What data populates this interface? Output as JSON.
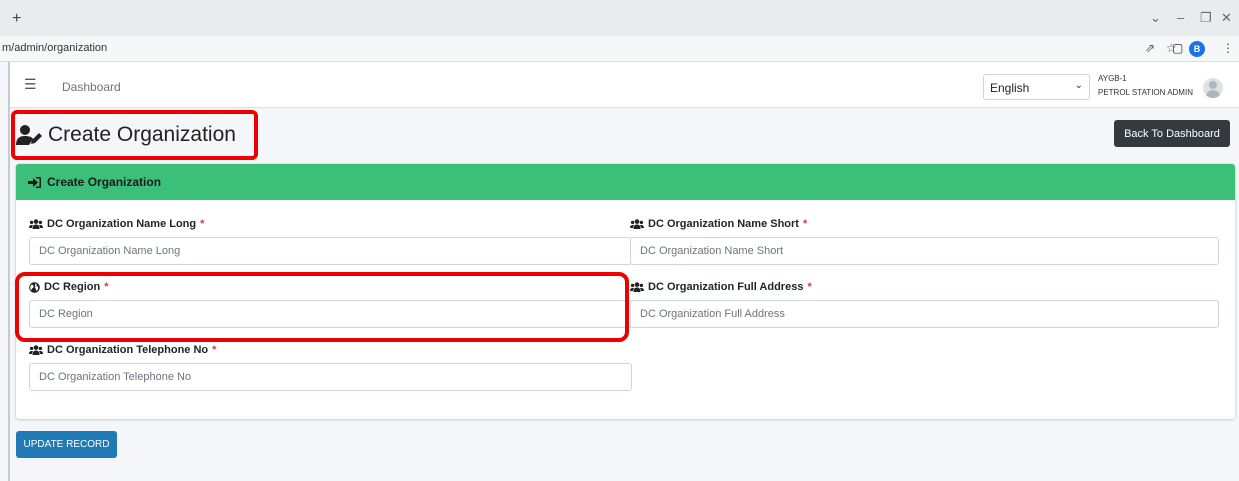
{
  "browser": {
    "new_tab": "+",
    "url": "m/admin/organization",
    "profile_initial": "B"
  },
  "navbar": {
    "dashboard_link": "Dashboard",
    "language": "English",
    "user_name": "AYGB-1",
    "user_role": "PETROL STATION ADMIN"
  },
  "page": {
    "title": "Create Organization",
    "back_button": "Back To Dashboard"
  },
  "form": {
    "header": "Create Organization",
    "required_marker": "*",
    "fields": {
      "name_long": {
        "label": "DC Organization Name Long",
        "placeholder": "DC Organization Name Long",
        "icon": "users-icon"
      },
      "name_short": {
        "label": "DC Organization Name Short",
        "placeholder": "DC Organization Name Short",
        "icon": "users-icon"
      },
      "region": {
        "label": "DC Region",
        "placeholder": "DC Region",
        "icon": "globe-icon"
      },
      "full_address": {
        "label": "DC Organization Full Address",
        "placeholder": "DC Organization Full Address",
        "icon": "users-icon"
      },
      "telephone": {
        "label": "DC Organization Telephone No",
        "placeholder": "DC Organization Telephone No",
        "icon": "users-icon"
      }
    },
    "submit_button": "UPDATE RECORD"
  },
  "colors": {
    "header_green": "#3cc079",
    "dark_button": "#343a40",
    "blue_button": "#1f7ab5",
    "highlight_red": "#ee0000",
    "required_red": "#dc3545"
  }
}
